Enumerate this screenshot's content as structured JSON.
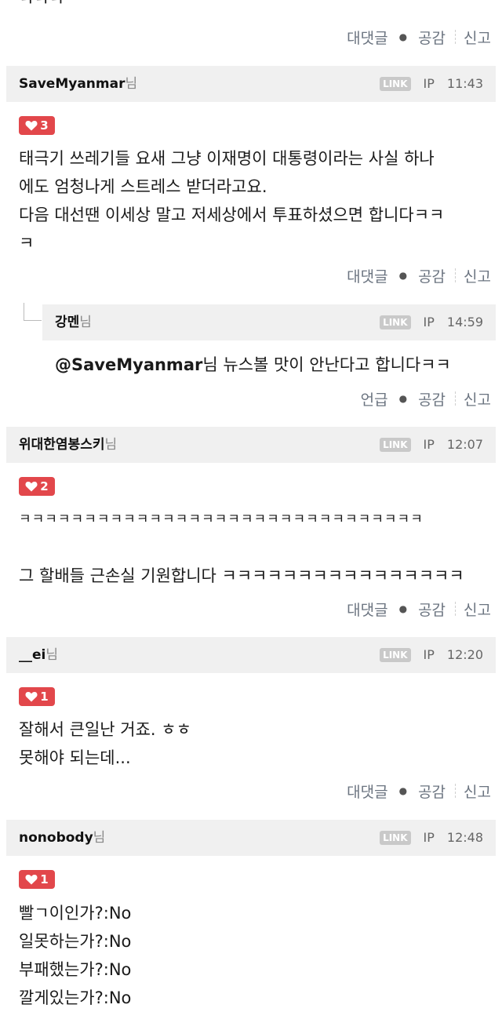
{
  "actions": {
    "reply": "대댓글",
    "mention": "언급",
    "like": "공감",
    "report": "신고"
  },
  "meta": {
    "link": "LINK",
    "ip": "IP"
  },
  "nick_suffix": "님",
  "top_fragment": "ㅋㅋㅋ",
  "comments": [
    {
      "author": "SaveMyanmar",
      "time": "11:43",
      "likes": "3",
      "lines": [
        "태극기 쓰레기들 요새 그냥 이재명이 대통령이라는 사실 하나",
        "에도 엄청나게 스트레스 받더라고요.",
        "다음 대선땐 이세상 말고 저세상에서 투표하셨으면 합니다ㅋㅋ",
        "ㅋ"
      ],
      "reply": {
        "author": "강멘",
        "time": "14:59",
        "mention": "@SaveMyanmar",
        "text": "님 뉴스볼 맛이 안난다고 합니다ㅋㅋ"
      }
    },
    {
      "author": "위대한염봉스키",
      "time": "12:07",
      "likes": "2",
      "lines": [
        "ㅋㅋㅋㅋㅋㅋㅋㅋㅋㅋㅋㅋㅋㅋㅋㅋㅋㅋㅋㅋㅋㅋㅋㅋㅋㅋㅋㅋㅋㅋㅋ",
        "",
        "그 할배들 근손실 기원합니다 ㅋㅋㅋㅋㅋㅋㅋㅋㅋㅋㅋㅋㅋㅋㅋㅋ"
      ]
    },
    {
      "author": "__ei",
      "time": "12:20",
      "likes": "1",
      "lines": [
        "잘해서 큰일난 거죠. ㅎㅎ",
        "못해야 되는데..."
      ]
    },
    {
      "author": "nonobody",
      "time": "12:48",
      "likes": "1",
      "lines": [
        "빨ㄱ이인가?:No",
        "일못하는가?:No",
        "부패했는가?:No",
        "깔게있는가?:No"
      ]
    }
  ]
}
